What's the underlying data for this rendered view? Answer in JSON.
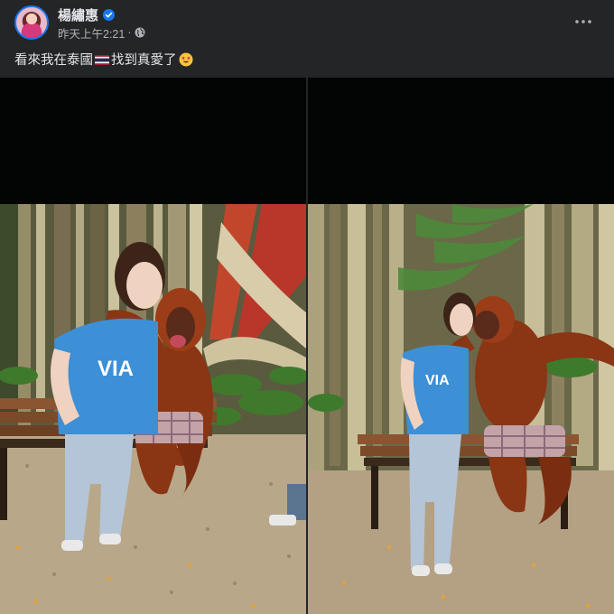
{
  "post": {
    "author": "楊繡惠",
    "timestamp": "昨天上午2:21",
    "separator": "·",
    "caption_part1": "看來我在泰國",
    "caption_part2": "找到真愛了"
  },
  "icons": {
    "verified": "verified-badge-icon",
    "privacy": "globe-icon",
    "more": "more-options-icon",
    "flag": "thailand-flag-icon",
    "emoji": "star-struck-emoji-icon"
  },
  "photos": [
    {
      "label": "woman-with-orangutan-left"
    },
    {
      "label": "woman-with-orangutan-right"
    }
  ],
  "colors": {
    "background": "#242526",
    "text_primary": "#e4e6eb",
    "text_secondary": "#b0b3b8",
    "verified_blue": "#1877f2"
  }
}
